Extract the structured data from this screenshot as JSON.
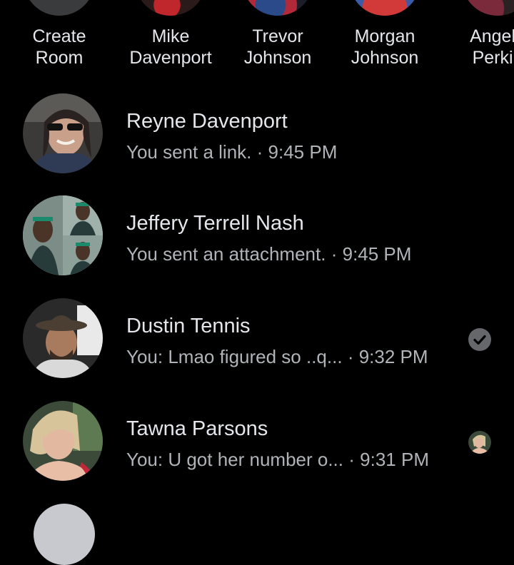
{
  "stories": [
    {
      "line1": "Create",
      "line2": "Room"
    },
    {
      "line1": "Mike",
      "line2": "Davenport"
    },
    {
      "line1": "Trevor",
      "line2": "Johnson"
    },
    {
      "line1": "Morgan",
      "line2": "Johnson"
    },
    {
      "line1": "Angela",
      "line2": "Perkin"
    }
  ],
  "conversations": [
    {
      "name": "Reyne Davenport",
      "preview": "You sent a link.",
      "separator": "·",
      "time": "9:45 PM"
    },
    {
      "name": "Jeffery Terrell Nash",
      "preview": "You sent an attachment.",
      "separator": "·",
      "time": "9:45 PM"
    },
    {
      "name": "Dustin Tennis",
      "preview": "You: Lmao figured so ..q...",
      "separator": "·",
      "time": "9:32 PM",
      "status_icon": "seen-check-icon"
    },
    {
      "name": "Tawna Parsons",
      "preview": "You: U got her number o...",
      "separator": "·",
      "time": "9:31 PM",
      "status_icon": "read-receipt-avatar"
    }
  ],
  "colors": {
    "background": "#000000",
    "primary_text": "#e4e6eb",
    "secondary_text": "#b0b3b8",
    "check_badge": "#65676b"
  }
}
